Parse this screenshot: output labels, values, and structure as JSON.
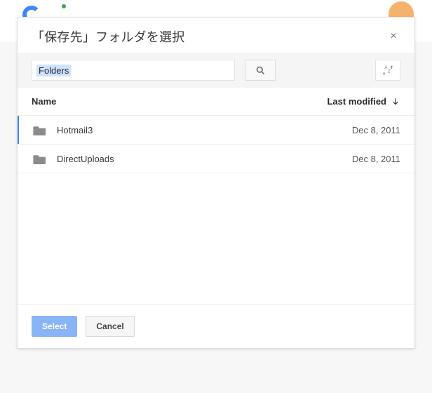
{
  "dialog": {
    "title": "「保存先」フォルダを選択",
    "close_label": "×"
  },
  "search": {
    "value": "Folders"
  },
  "icons": {
    "search": "search-icon",
    "sort": "sort-az-icon",
    "arrow_down": "arrow-down-icon"
  },
  "columns": {
    "name": "Name",
    "modified": "Last modified"
  },
  "rows": [
    {
      "name": "Hotmail3",
      "modified": "Dec 8, 2011"
    },
    {
      "name": "DirectUploads",
      "modified": "Dec 8, 2011"
    }
  ],
  "buttons": {
    "select": "Select",
    "cancel": "Cancel"
  }
}
